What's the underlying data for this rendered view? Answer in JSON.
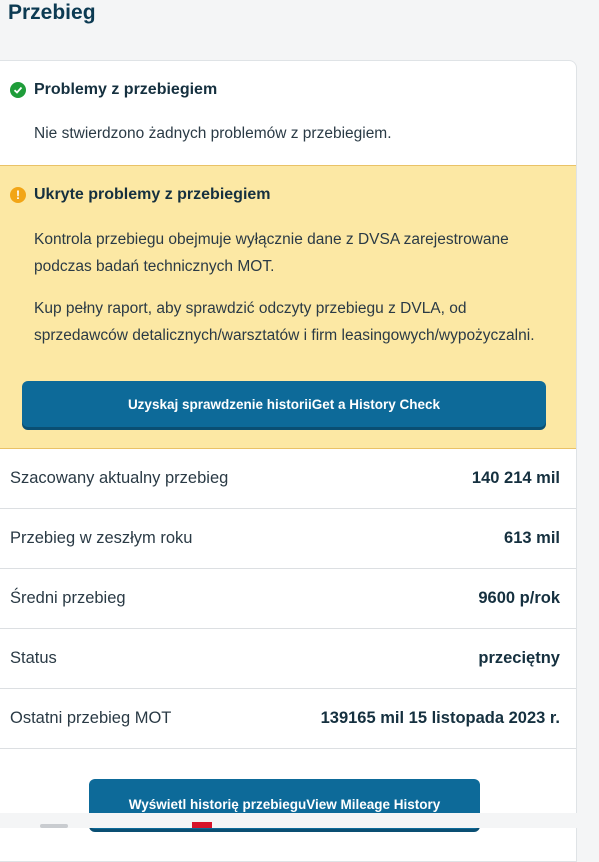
{
  "page": {
    "title": "Przebieg"
  },
  "ok_section": {
    "title": "Problemy z przebiegiem",
    "text": "Nie stwierdzono żadnych problemów z przebiegiem."
  },
  "warn_section": {
    "title": "Ukryte problemy z przebiegiem",
    "para1": "Kontrola przebiegu obejmuje wyłącznie dane z DVSA zarejestrowane podczas badań technicznych MOT.",
    "para2": "Kup pełny raport, aby sprawdzić odczyty przebiegu z DVLA, od sprzedawców detalicznych/warsztatów i firm leasingowych/wypożyczalni.",
    "button": "Uzyskaj sprawdzenie historiiGet a History Check"
  },
  "stats": [
    {
      "label": "Szacowany aktualny przebieg",
      "value": "140 214 mil"
    },
    {
      "label": "Przebieg w zeszłym roku",
      "value": "613 mil"
    },
    {
      "label": "Średni przebieg",
      "value": "9600 p/rok"
    },
    {
      "label": "Status",
      "value": "przeciętny"
    },
    {
      "label": "Ostatni przebieg MOT",
      "value": "139165 mil 15 listopada 2023 r."
    }
  ],
  "history_button": "Wyświetl historię przebieguView Mileage History",
  "icons": {
    "ok": "check-circle-icon",
    "warn": "exclamation-circle-icon"
  },
  "colors": {
    "accent": "#0d6a99",
    "warning_bg": "#fce8a4",
    "ok": "#1f9d3a",
    "warn": "#f2a516"
  }
}
